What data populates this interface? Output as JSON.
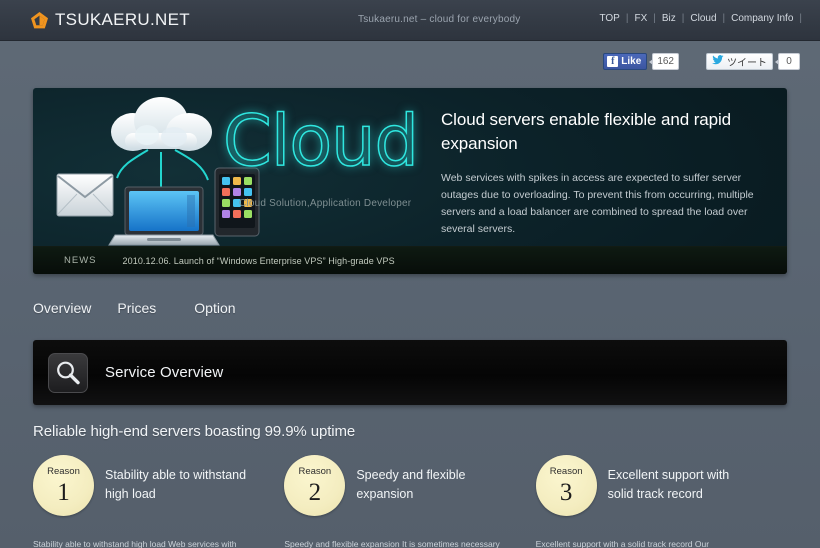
{
  "header": {
    "logo_text": "TSUKAERU.NET",
    "logo_icon": "pentagon-logo-icon",
    "tagline": "Tsukaeru.net – cloud for everybody",
    "nav": [
      {
        "label": "TOP"
      },
      {
        "label": "FX"
      },
      {
        "label": "Biz"
      },
      {
        "label": "Cloud"
      },
      {
        "label": "Company Info"
      }
    ],
    "nav_separator": "|",
    "accent_color": "#f0941f",
    "bar_color": "#343b45"
  },
  "social": {
    "facebook": {
      "icon": "facebook-icon",
      "glyph": "f",
      "label": "Like",
      "count": "162"
    },
    "twitter": {
      "icon": "twitter-bird-icon",
      "glyph": "🐦",
      "label": "ツイート",
      "count": "0"
    }
  },
  "hero": {
    "wordmark": "Cloud",
    "wordmark_color": "#2fe7e0",
    "subtitle": "Cloud Solution,Application Developer",
    "art_icon": "cloud-devices-illustration",
    "headline": "Cloud servers enable flexible and rapid expansion",
    "paragraph": "Web services with spikes in access are expected to suffer server outages due to overloading. To prevent this from occurring, multiple servers and a load balancer are combined to spread the load over several servers.",
    "news_label": "NEWS",
    "news_text": "2010.12.06. Launch of “Windows Enterprise VPS” High-grade VPS"
  },
  "tabs": [
    {
      "label": "Overview"
    },
    {
      "label": "Prices"
    },
    {
      "label": "Option"
    }
  ],
  "section": {
    "icon": "magnifier-icon",
    "title": "Service Overview"
  },
  "lead_heading": "Reliable high-end servers boasting 99.9% uptime",
  "reasons": [
    {
      "badge_word": "Reason",
      "badge_number": "1",
      "title": "Stability able to withstand high load",
      "body": "Stability able to withstand high load Web services with"
    },
    {
      "badge_word": "Reason",
      "badge_number": "2",
      "title": "Speedy and flexible expansion",
      "body": "Speedy and flexible expansion It is sometimes necessary"
    },
    {
      "badge_word": "Reason",
      "badge_number": "3",
      "title": "Excellent support with solid track record",
      "body": "Excellent support with a solid track record Our"
    }
  ]
}
